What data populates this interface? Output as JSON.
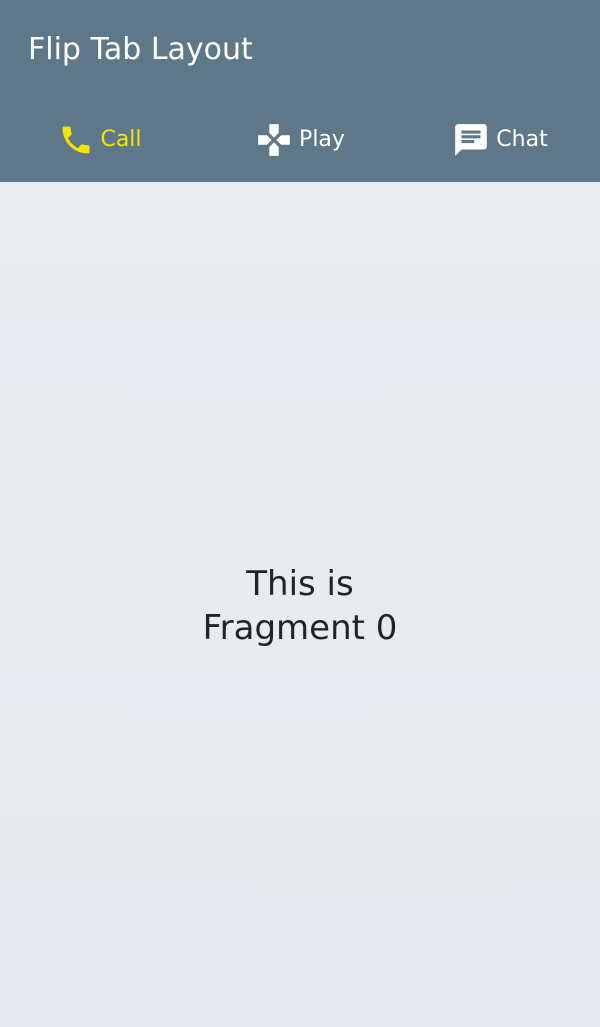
{
  "app_bar": {
    "title": "Flip Tab Layout",
    "background": "#5f7889"
  },
  "tabs": [
    {
      "label": "Call",
      "icon": "phone-icon",
      "active": true
    },
    {
      "label": "Play",
      "icon": "gamepad-icon",
      "active": false
    },
    {
      "label": "Chat",
      "icon": "chat-icon",
      "active": false
    }
  ],
  "colors": {
    "active_tab": "#f2e600",
    "inactive_tab": "#ffffff",
    "content_background": "#e8ecef"
  },
  "content": {
    "text": "This is Fragment 0"
  }
}
